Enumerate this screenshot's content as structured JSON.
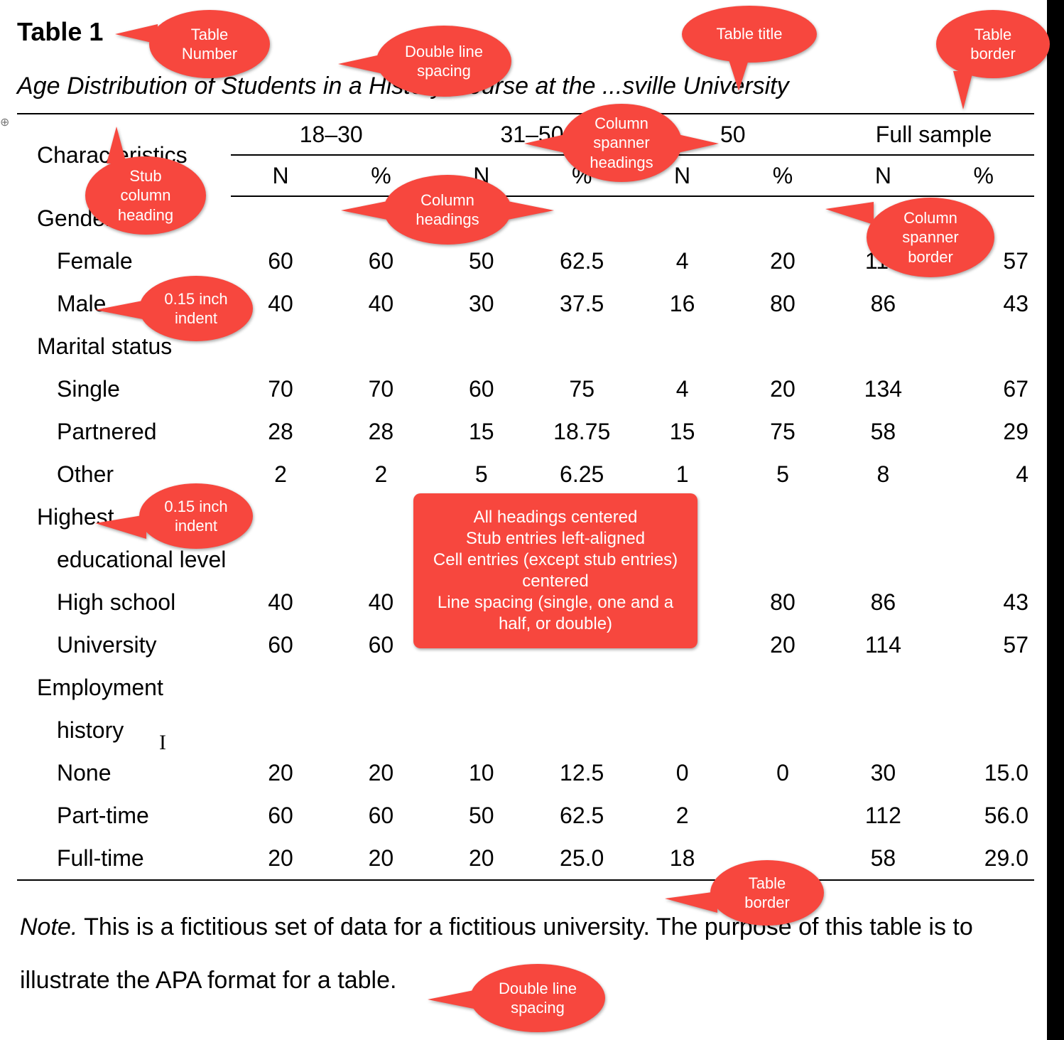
{
  "table_number": "Table 1",
  "table_title": "Age Distribution of Students in a History Course at the ...sville University",
  "headers": {
    "stub": "Characteristics",
    "spanners": [
      "18–30",
      "31–50",
      "50",
      "Full sample"
    ],
    "sub": [
      "N",
      "%",
      "N",
      "%",
      "N",
      "%",
      "N",
      "%"
    ]
  },
  "groups": [
    {
      "label": "Gender",
      "rows": [
        {
          "label": "Female",
          "vals": [
            "60",
            "60",
            "50",
            "62.5",
            "4",
            "20",
            "114",
            "57"
          ]
        },
        {
          "label": "Male",
          "vals": [
            "40",
            "40",
            "30",
            "37.5",
            "16",
            "80",
            "86",
            "43"
          ]
        }
      ]
    },
    {
      "label": "Marital status",
      "rows": [
        {
          "label": "Single",
          "vals": [
            "70",
            "70",
            "60",
            "75",
            "4",
            "20",
            "134",
            "67"
          ]
        },
        {
          "label": "Partnered",
          "vals": [
            "28",
            "28",
            "15",
            "18.75",
            "15",
            "75",
            "58",
            "29"
          ]
        },
        {
          "label": "Other",
          "vals": [
            "2",
            "2",
            "5",
            "6.25",
            "1",
            "5",
            "8",
            "4"
          ]
        }
      ]
    },
    {
      "label": "Highest",
      "label2": "educational level",
      "rows": [
        {
          "label": "High school",
          "vals": [
            "40",
            "40",
            "",
            "",
            "",
            "80",
            "86",
            "43"
          ]
        },
        {
          "label": "University",
          "vals": [
            "60",
            "60",
            "",
            "",
            "",
            "20",
            "114",
            "57"
          ]
        }
      ]
    },
    {
      "label": "Employment",
      "label2": "history",
      "rows": [
        {
          "label": "None",
          "vals": [
            "20",
            "20",
            "10",
            "12.5",
            "0",
            "0",
            "30",
            "15.0"
          ]
        },
        {
          "label": "Part-time",
          "vals": [
            "60",
            "60",
            "50",
            "62.5",
            "2",
            "",
            "112",
            "56.0"
          ]
        },
        {
          "label": "Full-time",
          "vals": [
            "20",
            "20",
            "20",
            "25.0",
            "18",
            "",
            "58",
            "29.0"
          ]
        }
      ]
    }
  ],
  "note_label": "Note.",
  "note_text": " This is a fictitious set of data for a fictitious university. The purpose of this table is to illustrate the APA format for a table.",
  "callouts": {
    "table_number": "Table\nNumber",
    "double_line_top": "Double line\nspacing",
    "table_title": "Table title",
    "table_border_top": "Table\nborder",
    "col_spanner": "Column\nspanner\nheadings",
    "stub_col": "Stub\ncolumn\nheading",
    "col_headings": "Column\nheadings",
    "col_spanner_border": "Column\nspanner\nborder",
    "indent1": "0.15 inch\nindent",
    "indent2": "0.15 inch\nindent",
    "center_box": "All headings centered\nStub entries left-aligned\nCell entries (except stub entries)\ncentered\nLine spacing (single, one and a\nhalf, or double)",
    "table_border_bot": "Table\nborder",
    "double_line_bot": "Double line\nspacing"
  }
}
